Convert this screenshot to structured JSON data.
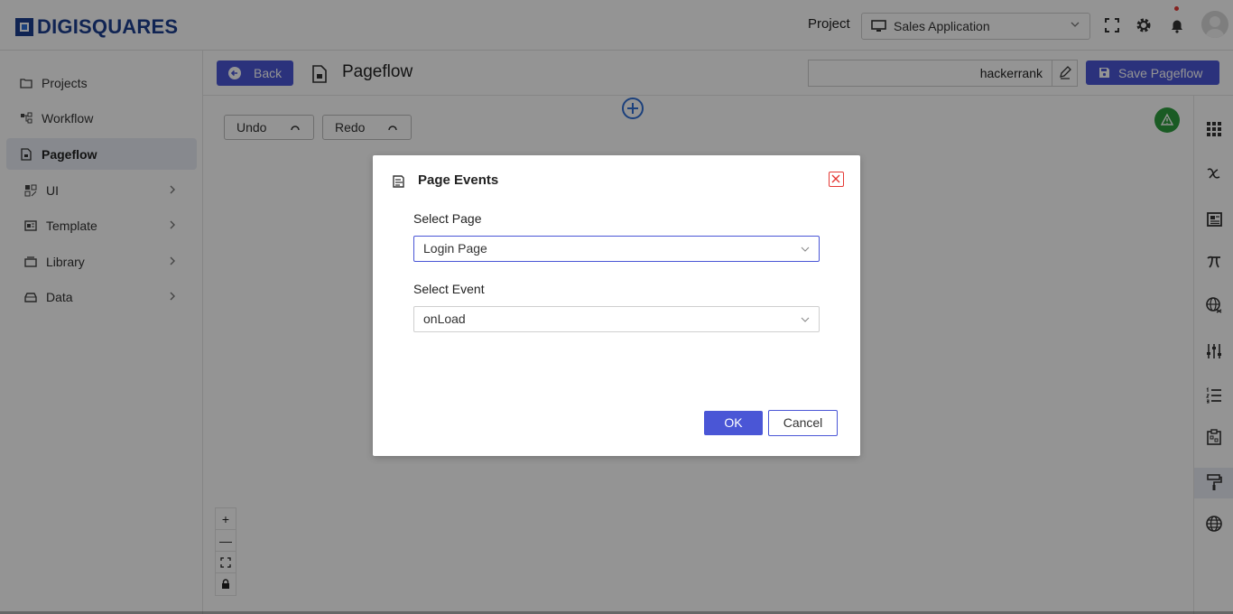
{
  "header": {
    "logo_text": "DIGISQUARES",
    "project_label": "Project",
    "project_value": "Sales Application"
  },
  "sidebar": {
    "items": [
      {
        "label": "Projects",
        "icon": "folder-icon"
      },
      {
        "label": "Workflow",
        "icon": "workflow-icon"
      },
      {
        "label": "Pageflow",
        "icon": "page-icon",
        "active": true
      },
      {
        "label": "UI",
        "icon": "ui-icon",
        "expandable": true
      },
      {
        "label": "Template",
        "icon": "template-icon",
        "expandable": true
      },
      {
        "label": "Library",
        "icon": "library-icon",
        "expandable": true
      },
      {
        "label": "Data",
        "icon": "data-icon",
        "expandable": true
      }
    ]
  },
  "toolbar": {
    "back_label": "Back",
    "page_title": "Pageflow",
    "name_value": "hackerrank",
    "save_label": "Save Pageflow"
  },
  "canvas": {
    "undo_label": "Undo",
    "redo_label": "Redo",
    "zoom_in": "+",
    "zoom_out": "—"
  },
  "modal": {
    "title": "Page Events",
    "select_page_label": "Select Page",
    "select_page_value": "Login Page",
    "select_event_label": "Select Event",
    "select_event_value": "onLoad",
    "ok_label": "OK",
    "cancel_label": "Cancel"
  },
  "colors": {
    "primary": "#4a56d6",
    "brand": "#1d3f8f",
    "success": "#2e9e3e",
    "danger": "#e53935"
  }
}
